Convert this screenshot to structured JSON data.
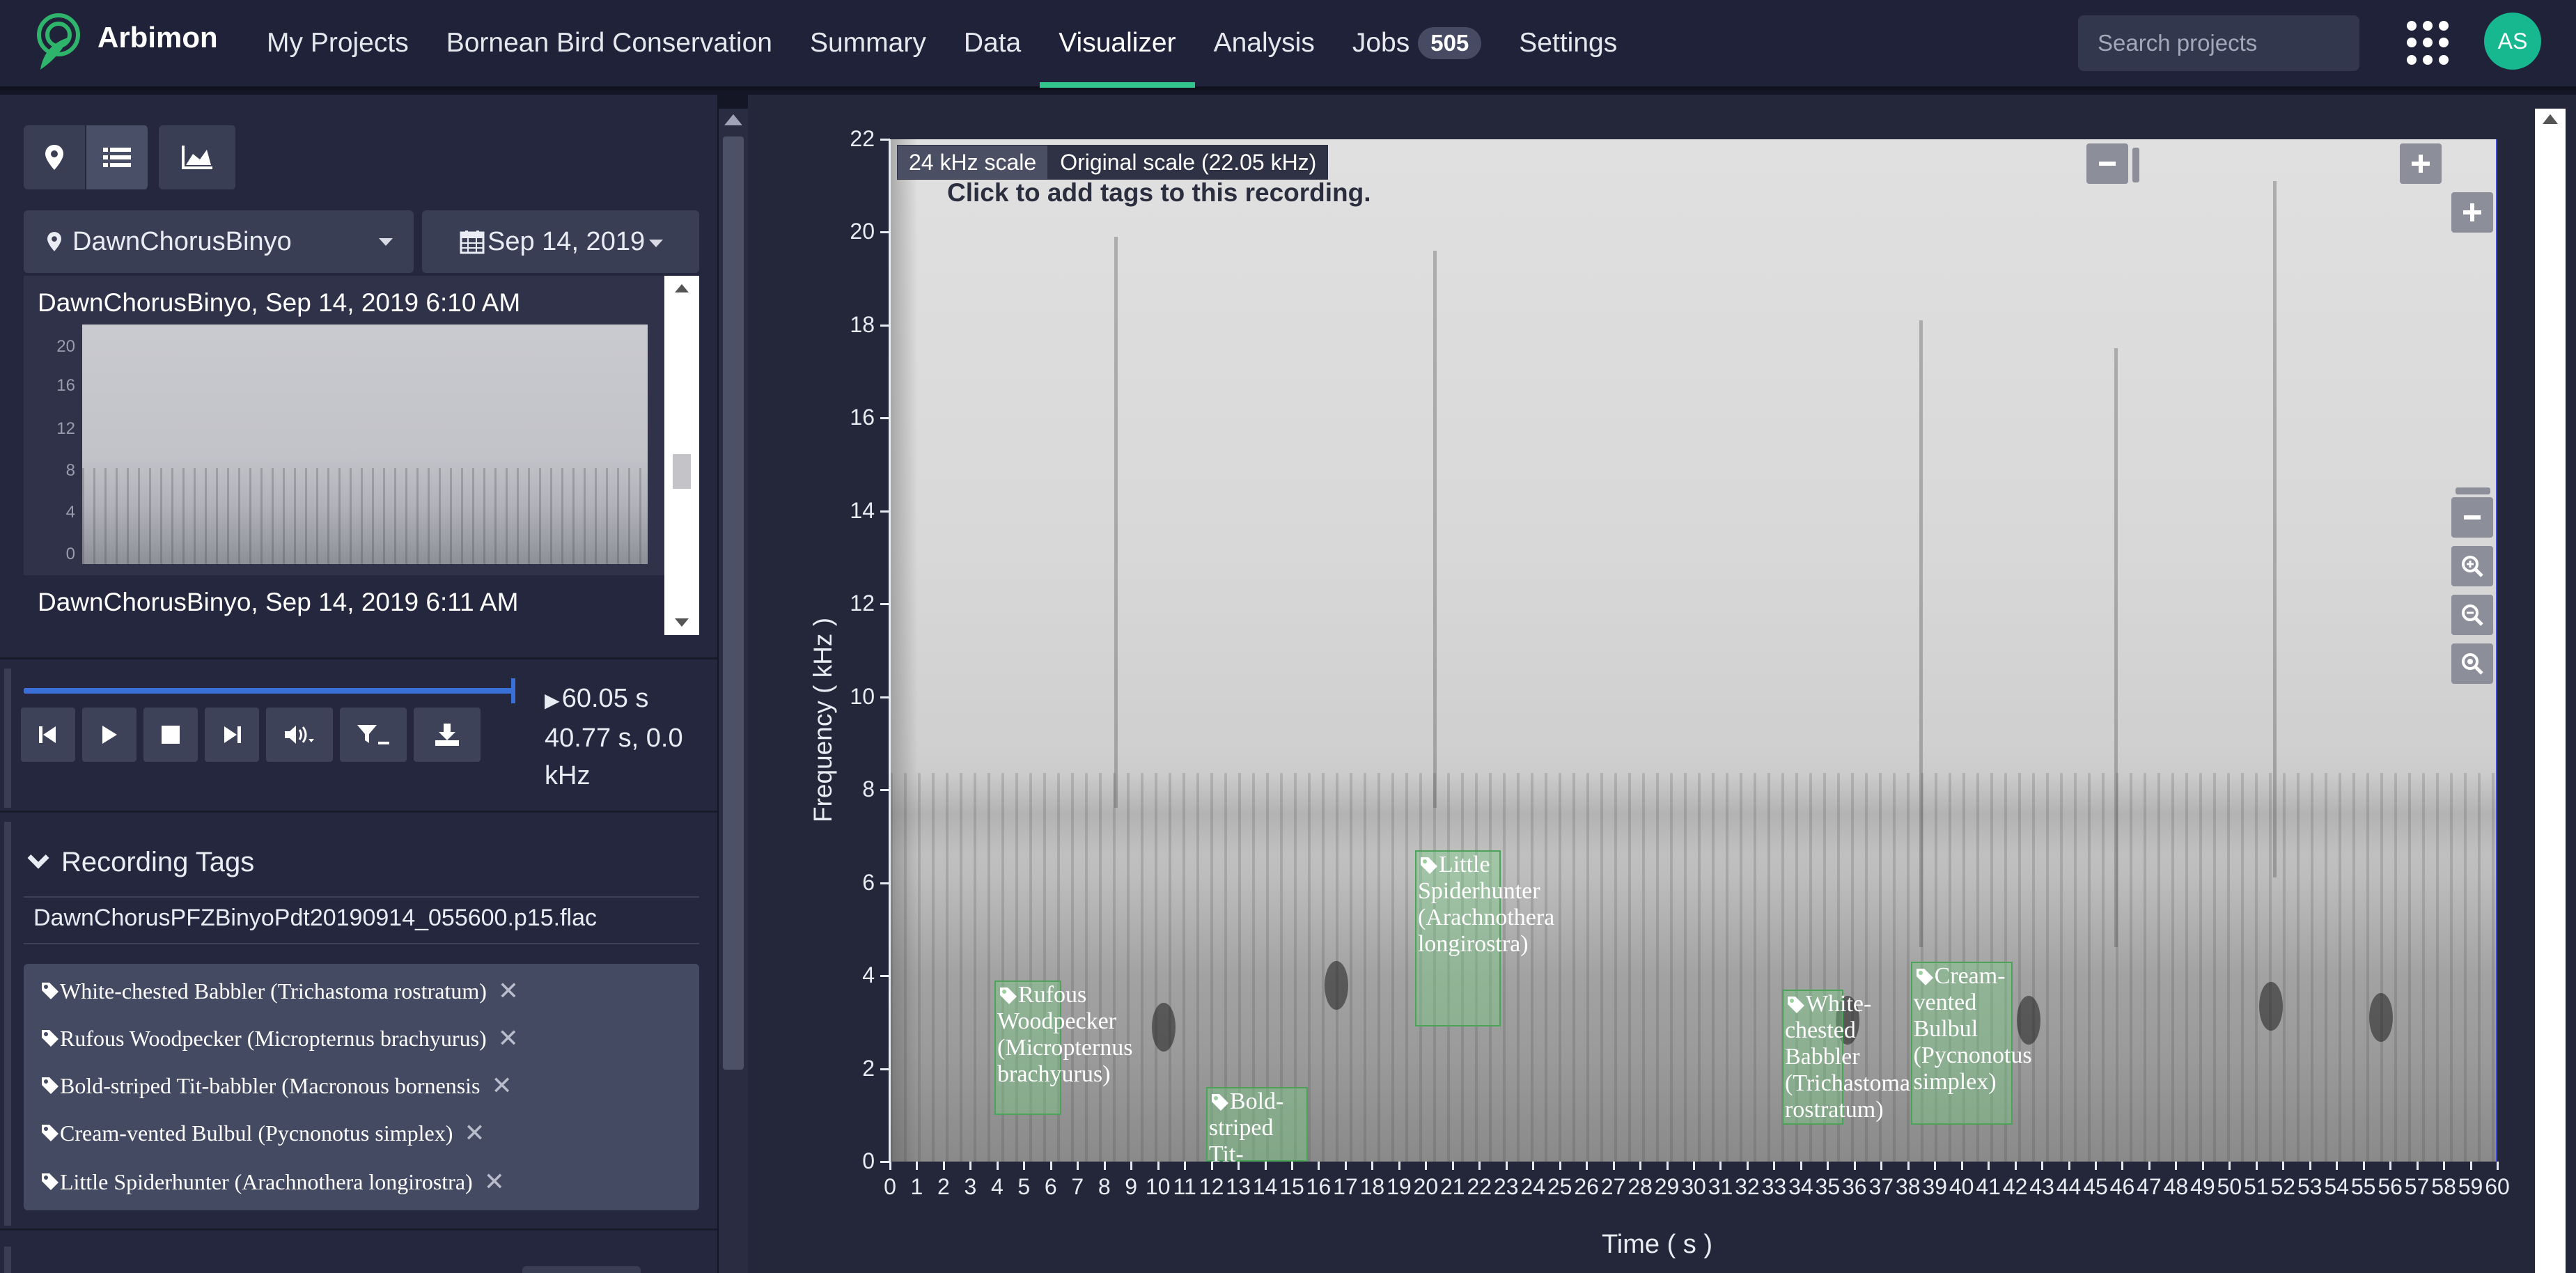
{
  "app": {
    "name": "Arbimon"
  },
  "nav": {
    "items": [
      {
        "label": "My Projects",
        "name": "nav-my-projects"
      },
      {
        "label": "Bornean Bird Conservation",
        "name": "nav-project"
      },
      {
        "label": "Summary",
        "name": "nav-summary"
      },
      {
        "label": "Data",
        "name": "nav-data"
      },
      {
        "label": "Visualizer",
        "name": "nav-visualizer"
      },
      {
        "label": "Analysis",
        "name": "nav-analysis"
      }
    ],
    "jobs": {
      "label": "Jobs",
      "count": "505"
    },
    "settings": "Settings",
    "active": "Visualizer"
  },
  "search": {
    "placeholder": "Search projects"
  },
  "user": {
    "initials": "AS"
  },
  "sidebar": {
    "modes": [
      "map-marker-icon",
      "list-icon",
      "area-chart-icon"
    ],
    "site": "DawnChorusBinyo",
    "date": "Sep 14, 2019",
    "recordings": [
      {
        "title": "DawnChorusBinyo, Sep 14, 2019 6:10 AM"
      },
      {
        "title": "DawnChorusBinyo, Sep 14, 2019 6:11 AM"
      }
    ],
    "thumb_axis": [
      "20",
      "16",
      "12",
      "8",
      "4",
      "0"
    ],
    "player": {
      "progress": 1.0,
      "duration": "60.05 s",
      "cursor_line1": "40.77 s, 0.0",
      "cursor_line2": "kHz"
    },
    "recording_tags": {
      "header": "Recording Tags",
      "filename": "DawnChorusPFZBinyoPdt20190914_055600.p15.flac",
      "tags": [
        "White-chested Babbler (Trichastoma rostratum)",
        "Rufous Woodpecker (Micropternus brachyurus)",
        "Bold-striped Tit-babbler (Macronous bornensis",
        "Cream-vented Bulbul (Pycnonotus simplex)",
        "Little Spiderhunter (Arachnothera longirostra)"
      ]
    }
  },
  "visualizer": {
    "scale_options": [
      "24 kHz scale",
      "Original scale (22.05 kHz)"
    ],
    "selected_scale": "Original scale (22.05 kHz)",
    "hint": "Click to add tags to this recording.",
    "y_axis": {
      "title": "Frequency ( kHz )",
      "ticks": [
        "0",
        "2",
        "4",
        "6",
        "8",
        "10",
        "12",
        "14",
        "16",
        "18",
        "20",
        "22"
      ],
      "min": 0,
      "max": 22
    },
    "x_axis": {
      "title": "Time ( s )",
      "min": 0,
      "max": 60
    },
    "annotations": [
      {
        "label": "Rufous\nWoodpecker\n(Micropternus\nbrachyurus)",
        "t0": 3.9,
        "t1": 6.4,
        "f0": 1.0,
        "f1": 3.9
      },
      {
        "label": "Bold-\nstriped Tit-\nbabbler",
        "t0": 11.8,
        "t1": 15.6,
        "f0": 0.0,
        "f1": 1.6
      },
      {
        "label": "Little\nSpiderhunter\n(Arachnothera\nlongirostra)",
        "t0": 19.6,
        "t1": 22.8,
        "f0": 2.9,
        "f1": 6.7
      },
      {
        "label": "White-\nchested\nBabbler\n(Trichastoma\nrostratum)",
        "t0": 33.3,
        "t1": 35.6,
        "f0": 0.8,
        "f1": 3.7
      },
      {
        "label": "Cream-\nvented\nBulbul\n(Pycnonotus\nsimplex)",
        "t0": 38.1,
        "t1": 41.9,
        "f0": 0.8,
        "f1": 4.3
      }
    ],
    "zoom_controls": [
      "minus-icon",
      "plus-icon",
      "zoom-in-icon",
      "zoom-out-icon",
      "zoom-reset-icon"
    ]
  }
}
